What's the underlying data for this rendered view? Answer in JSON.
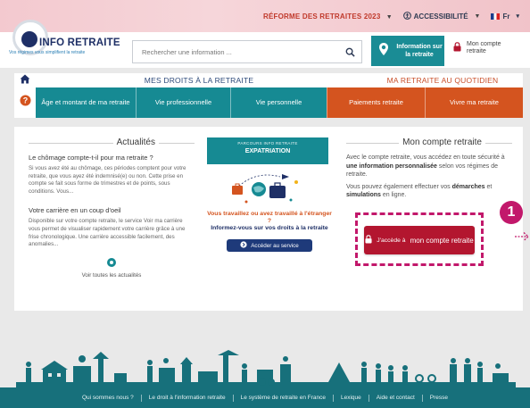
{
  "topbar": {
    "reform": "RÉFORME DES RETRAITES 2023",
    "accessibility": "ACCESSIBILITÉ",
    "lang": "Fr"
  },
  "brand": {
    "name": "INFO RETRAITE",
    "tagline": "Vos régimes vous simplifient la retraite"
  },
  "search": {
    "placeholder": "Rechercher une information ..."
  },
  "header": {
    "info_button": "Information sur la retraite",
    "account_link": "Mon compte retraite"
  },
  "nav": {
    "section_left": "MES DROITS À LA RETRAITE",
    "section_right": "MA RETRAITE AU QUOTIDIEN",
    "tabs": [
      {
        "label": "Âge et montant de ma retraite",
        "color": "#168a93"
      },
      {
        "label": "Vie professionnelle",
        "color": "#168a93"
      },
      {
        "label": "Vie personnelle",
        "color": "#168a93"
      },
      {
        "label": "Paiements retraite",
        "color": "#d4541f"
      },
      {
        "label": "Vivre ma retraite",
        "color": "#d4541f"
      }
    ]
  },
  "news": {
    "title": "Actualités",
    "item1_title": "Le chômage compte-t-il pour ma retraite ?",
    "item1_text": "Si vous avez été au chômage, ces périodes comptent pour votre retraite, que vous ayez été indemnisé(e) ou non. Cette prise en compte se fait sous forme de trimestres et de points, sous conditions.   Vous...",
    "item2_title": "Votre carrière en un coup d'oeil",
    "item2_text": "Disponible sur votre compte retraite, le service Voir ma carrière vous permet de visualiser rapidement votre carrière grâce à une frise chronologique.   Une carrière accessible facilement, des anomalies...",
    "see_all": "Voir toutes les actualités"
  },
  "promo": {
    "kicker": "PARCOURS INFO RETRAITE",
    "title": "EXPATRIATION",
    "question": "Vous travaillez ou avez travaillé à l'étranger ?",
    "subline": "Informez-vous sur vos droits à la retraite",
    "cta": "Accéder au service"
  },
  "account": {
    "title": "Mon compte retraite",
    "p1_a": "Avec le compte retraite, vous accédez en toute sécurité à ",
    "p1_b": "une information personnalisée",
    "p1_c": " selon vos régimes de retraite.",
    "p2_a": "Vous pouvez également effectuer vos ",
    "p2_b": "démarches",
    "p2_c": " et ",
    "p2_d": "simulations",
    "p2_e": " en ligne.",
    "button_prefix": "J'accède à",
    "button_main": "mon compte retraite",
    "badge": "1"
  },
  "footer": {
    "links": [
      "Qui sommes nous ?",
      "Le droit à l'information retraite",
      "Le système de retraite en France",
      "Lexique",
      "Aide et contact",
      "Presse"
    ]
  },
  "colors": {
    "teal": "#168a93",
    "orange": "#d4541f",
    "navy": "#1e2f66",
    "cta_red": "#b3162f",
    "highlight_magenta": "#c2186b",
    "footer_bg": "#17707b"
  }
}
